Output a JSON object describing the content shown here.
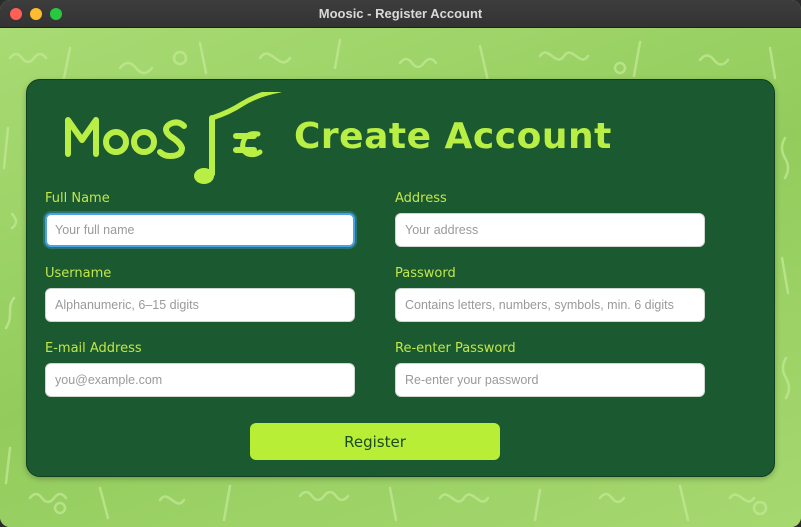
{
  "window": {
    "title": "Moosic - Register Account"
  },
  "logo": {
    "text": "MOOSIC"
  },
  "header": {
    "title": "Create Account"
  },
  "form": {
    "fields": [
      {
        "label": "Full Name",
        "value": "",
        "placeholder": "Your full name",
        "focused": true
      },
      {
        "label": "Address",
        "value": "",
        "placeholder": "Your address"
      },
      {
        "label": "Username",
        "value": "",
        "placeholder": "Alphanumeric, 6–15 digits"
      },
      {
        "label": "Password",
        "value": "",
        "placeholder": "Contains letters, numbers, symbols, min. 6 digits"
      },
      {
        "label": "E-mail Address",
        "value": "",
        "placeholder": "you@example.com"
      },
      {
        "label": "Re-enter Password",
        "value": "",
        "placeholder": "Re-enter your password"
      }
    ],
    "submit_label": "Register"
  },
  "colors": {
    "accent": "#b8ee35",
    "card": "#1b5a30",
    "background": "#9fd36a",
    "focus": "#4aa3e8"
  }
}
